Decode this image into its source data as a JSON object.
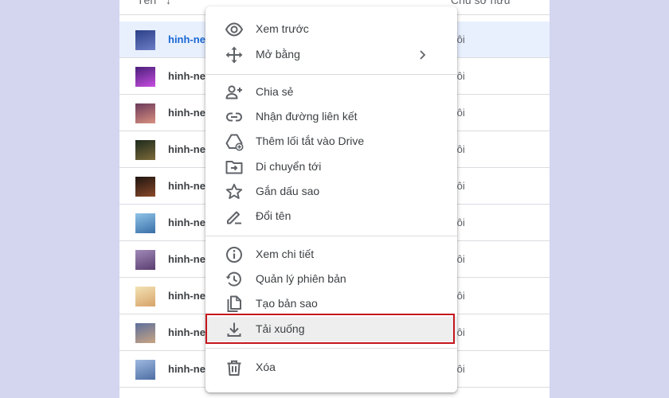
{
  "header": {
    "name_label": "Tên",
    "owner_label": "Chủ sở hữu"
  },
  "files": [
    {
      "name": "hinh-nen",
      "owner": "tôi",
      "thumb_colors": [
        "#2b3f88",
        "#6d7ec6"
      ]
    },
    {
      "name": "hinh-nen",
      "owner": "tôi",
      "thumb_colors": [
        "#4a1f7a",
        "#c74ee0"
      ]
    },
    {
      "name": "hinh-nen",
      "owner": "tôi",
      "thumb_colors": [
        "#6b3a5a",
        "#d99080"
      ]
    },
    {
      "name": "hinh-nen",
      "owner": "tôi",
      "thumb_colors": [
        "#1c2a1c",
        "#7d6a3a"
      ]
    },
    {
      "name": "hinh-nen",
      "owner": "tôi",
      "thumb_colors": [
        "#1e1410",
        "#8a4a2a"
      ]
    },
    {
      "name": "hinh-nen",
      "owner": "tôi",
      "thumb_colors": [
        "#8fc4e8",
        "#3a6fa8"
      ]
    },
    {
      "name": "hinh-nen",
      "owner": "tôi",
      "thumb_colors": [
        "#a08ab8",
        "#5a3e70"
      ]
    },
    {
      "name": "hinh-nen",
      "owner": "tôi",
      "thumb_colors": [
        "#f3e2b4",
        "#d7a36a"
      ]
    },
    {
      "name": "hinh-nen",
      "owner": "tôi",
      "thumb_colors": [
        "#5d6f9c",
        "#c9a583"
      ]
    },
    {
      "name": "hinh-nen",
      "owner": "tôi",
      "thumb_colors": [
        "#9fb9e0",
        "#4d6ea3"
      ]
    }
  ],
  "menu": {
    "preview": {
      "label": "Xem trước",
      "icon": "eye-icon"
    },
    "open_with": {
      "label": "Mở bằng",
      "icon": "move-arrows-icon"
    },
    "share": {
      "label": "Chia sẻ",
      "icon": "person-add-icon"
    },
    "get_link": {
      "label": "Nhận đường liên kết",
      "icon": "link-icon"
    },
    "add_shortcut": {
      "label": "Thêm lối tắt vào Drive",
      "icon": "add-shortcut-drive-icon"
    },
    "move_to": {
      "label": "Di chuyển tới",
      "icon": "folder-move-icon"
    },
    "star": {
      "label": "Gắn dấu sao",
      "icon": "star-outline-icon"
    },
    "rename": {
      "label": "Đổi tên",
      "icon": "pencil-icon"
    },
    "details": {
      "label": "Xem chi tiết",
      "icon": "info-icon"
    },
    "versions": {
      "label": "Quản lý phiên bản",
      "icon": "history-icon"
    },
    "copy": {
      "label": "Tạo bản sao",
      "icon": "copy-file-icon"
    },
    "download": {
      "label": "Tải xuống",
      "icon": "download-icon"
    },
    "delete": {
      "label": "Xóa",
      "icon": "trash-icon"
    }
  },
  "colors": {
    "accent_blue": "#1967d2",
    "selected_row": "#e8f0fe",
    "highlight_red": "#c4161c",
    "icon_gray": "#5f6368",
    "background": "#d4d6f0"
  }
}
